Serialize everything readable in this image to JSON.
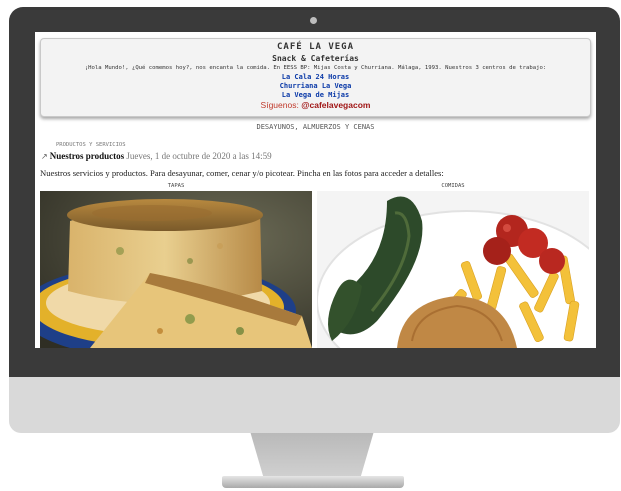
{
  "site": {
    "title": "CAFÉ LA VEGA",
    "subtitle": "Snack & Cafeterías",
    "intro": "¡Hola Mundo!, ¿Qué comemos hoy?, nos encanta la comida. En EESS BP: Mijas Costa y Churriana. Málaga, 1993. Nuestros 3 centros de trabajo:",
    "locations": [
      "La Cala 24 Horas",
      "Churriana La Vega",
      "La Vega de Mijas"
    ],
    "social_label": "Síguenos:",
    "social_handle": "@cafelavegacom"
  },
  "nav": {
    "label": "DESAYUNOS, ALMUERZOS Y CENAS"
  },
  "post": {
    "category": "PRODUCTOS Y SERVICIOS",
    "title": "Nuestros productos",
    "date": "Jueves, 1 de octubre de 2020 a las 14:59",
    "body": "Nuestros servicios y productos. Para desayunar, comer, cenar y/o picotear. Pincha en las fotos para acceder a detalles:"
  },
  "gallery": [
    {
      "label": "TAPAS",
      "image": "tortilla-photo"
    },
    {
      "label": "COMIDAS",
      "image": "plate-photo"
    }
  ],
  "colors": {
    "bezel": "#3a3a3a",
    "link": "#0b3aa8",
    "social": "#c0392b"
  }
}
